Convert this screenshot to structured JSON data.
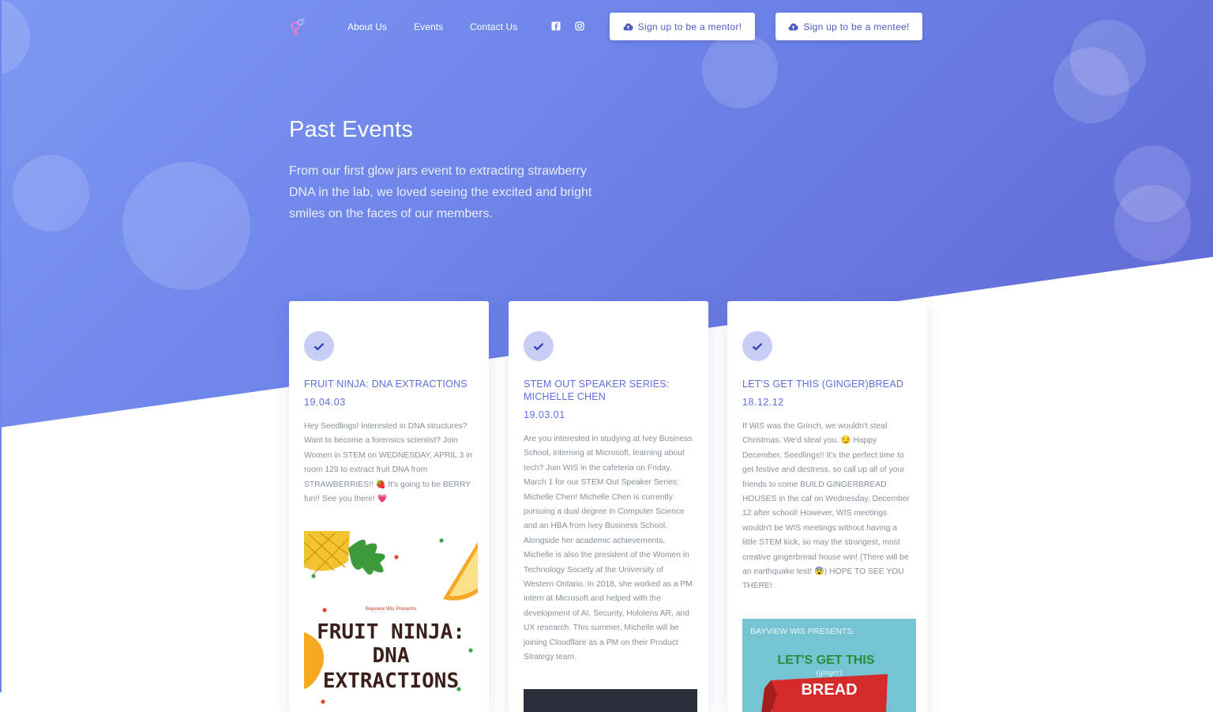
{
  "nav": {
    "logo_icon": "gender-symbols-logo",
    "links": [
      "About Us",
      "Events",
      "Contact Us"
    ],
    "social": [
      "facebook-icon",
      "instagram-icon"
    ],
    "mentor_button": "Sign up to be a mentor!",
    "mentee_button": "Sign up to be a mentee!"
  },
  "hero": {
    "title": "Past Events",
    "lead": "From our first glow jars event to extracting strawberry DNA in the lab, we loved seeing the excited and bright smiles on the faces of our members."
  },
  "events": [
    {
      "title": "FRUIT NINJA: DNA EXTRACTIONS",
      "date": "19.04.03",
      "body": "Hey Seedlings! Interested in DNA structures? Want to become a forensics scientist? Join Women in STEM on WEDNESDAY, APRIL 3 in room 129 to extract fruit DNA from STRAWBERRIES!! 🍓 It's going to be BERRY fun!! See you there! 💗",
      "poster": {
        "presenter": "Bayview Wis Presents",
        "line1": "FRUIT NINJA:",
        "line2": "DNA",
        "line3": "EXTRACTIONS"
      }
    },
    {
      "title": "STEM OUT SPEAKER SERIES: MICHELLE CHEN",
      "date": "19.03.01",
      "body": "Are you interested in studying at Ivey Business School, interning at Microsoft, learning about tech? Join WIS in the cafeteria on Friday, March 1 for our STEM Out Speaker Series: Michelle Chen! Michelle Chen is currently pursuing a dual degree in Computer Science and an HBA from Ivey Business School. Alongside her academic achievements, Michelle is also the president of the Women in Technology Society at the University of Western Ontario. In 2018, she worked as a PM intern at Microsoft and helped with the development of AI, Security, Hololens AR, and UX research. This summer, Michelle will be joining Cloudflare as a PM on their Product Strategy team."
    },
    {
      "title": "LET'S GET THIS (GINGER)BREAD",
      "date": "18.12.12",
      "body": "If WIS was the Grinch, we wouldn't steal Christmas. We'd steal you. 😏 Happy December, Seedlings!! It's the perfect time to get festive and destress, so call up all of your friends to come BUILD GINGERBREAD HOUSES in the caf on Wednesday, December 12 after school! However, WIS meetings wouldn't be WIS meetings without having a little STEM kick, so may the strongest, most creative gingerbread house win! (There will be an earthquake test! 😨) HOPE TO SEE YOU THERE!",
      "poster": {
        "presenter": "BAYVIEW WIS PRESENTS:",
        "line1": "LET'S GET THIS",
        "line2": "(ginger)",
        "line3": "BREAD"
      }
    }
  ],
  "colors": {
    "accent": "#5f6ee0",
    "hero_start": "#7c98f3",
    "hero_end": "#5d5fcf"
  }
}
